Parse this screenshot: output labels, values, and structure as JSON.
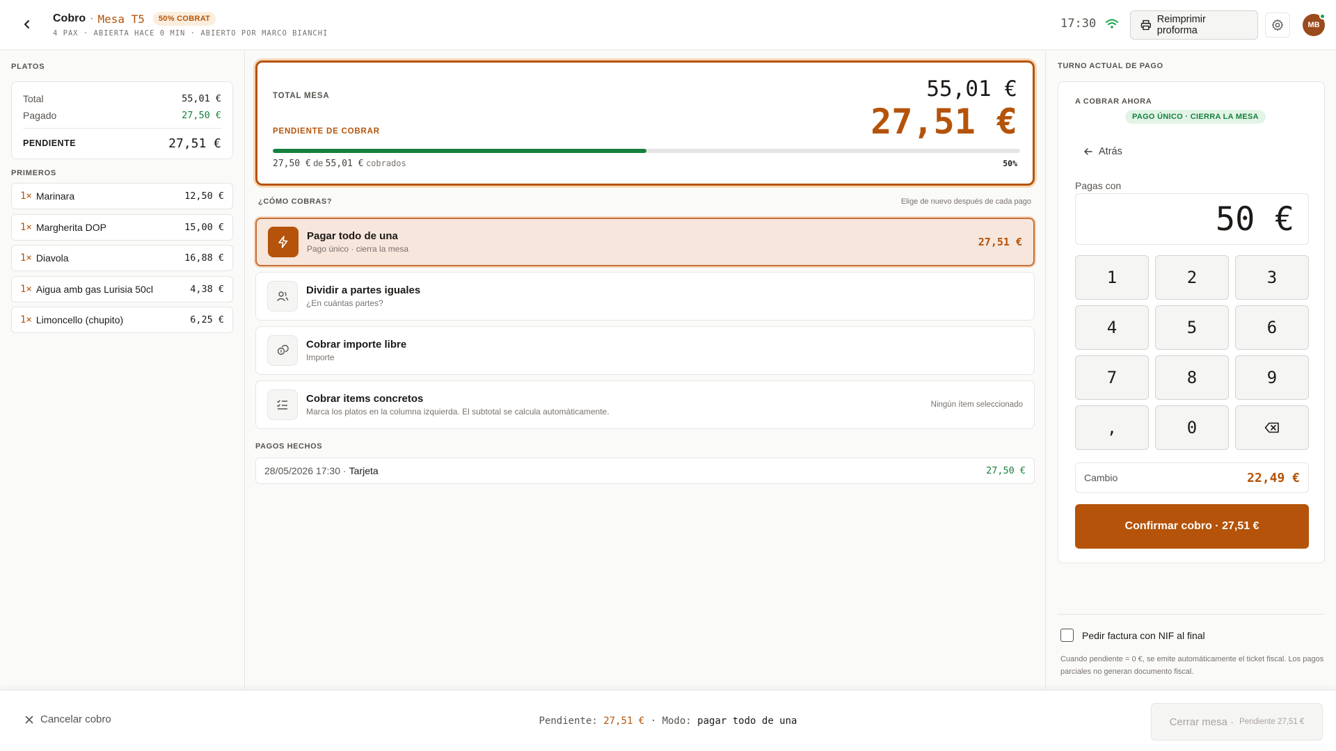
{
  "header": {
    "title": "Cobro",
    "separator": "·",
    "table": "Mesa T5",
    "badge": "50% COBRAT",
    "subtitle": "4 PAX · ABIERTA HACE 0 MIN · ABIERTO POR MARCO BIANCHI",
    "time": "17:30",
    "reprint_label": "Reimprimir proforma",
    "avatar_initials": "MB"
  },
  "left": {
    "platos_label": "PLATOS",
    "summary": {
      "total_label": "Total",
      "total_value": "55,01 €",
      "pagado_label": "Pagado",
      "pagado_value": "27,50 €",
      "pendiente_label": "PENDIENTE",
      "pendiente_value": "27,51 €"
    },
    "primeros_label": "PRIMEROS",
    "dishes": [
      {
        "qty": "1×",
        "name": "Marinara",
        "price": "12,50 €"
      },
      {
        "qty": "1×",
        "name": "Margherita DOP",
        "price": "15,00 €"
      },
      {
        "qty": "1×",
        "name": "Diavola",
        "price": "16,88 €"
      },
      {
        "qty": "1×",
        "name": "Aigua amb gas Lurisia 50cl",
        "price": "4,38 €"
      },
      {
        "qty": "1×",
        "name": "Limoncello (chupito)",
        "price": "6,25 €"
      }
    ]
  },
  "center": {
    "total_label": "TOTAL MESA",
    "total_value": "55,01 €",
    "pendiente_label": "PENDIENTE DE COBRAR",
    "pendiente_value": "27,51 €",
    "progress_fraction": 0.5,
    "progress_paid": "27,50 €",
    "progress_of": "de",
    "progress_total": "55,01 €",
    "progress_suffix": "cobrados",
    "progress_pct": "50%",
    "how_label": "¿CÓMO COBRAS?",
    "how_hint": "Elige de nuevo después de cada pago",
    "options": [
      {
        "title": "Pagar todo de una",
        "sub": "Pago único · cierra la mesa",
        "right": "27,51 €"
      },
      {
        "title": "Dividir a partes iguales",
        "sub": "¿En cuántas partes?",
        "right": ""
      },
      {
        "title": "Cobrar importe libre",
        "sub": "Importe",
        "right": ""
      },
      {
        "title": "Cobrar items concretos",
        "sub": "Marca los platos en la columna izquierda. El subtotal se calcula automáticamente.",
        "right": "Ningún ítem seleccionado"
      }
    ],
    "payments_label": "PAGOS HECHOS",
    "payments": [
      {
        "date": "28/05/2026 17:30",
        "sep": "·",
        "method": "Tarjeta",
        "amount": "27,50 €"
      }
    ]
  },
  "right": {
    "turn_label": "TURNO ACTUAL DE PAGO",
    "cobrar_label": "A COBRAR AHORA",
    "badge": "PAGO ÚNICO · CIERRA LA MESA",
    "back_label": "Atrás",
    "pagas_label": "Pagas con",
    "pagas_value": "50 €",
    "keys": [
      "1",
      "2",
      "3",
      "4",
      "5",
      "6",
      "7",
      "8",
      "9",
      ",",
      "0"
    ],
    "cambio_label": "Cambio",
    "cambio_value": "22,49 €",
    "confirm_label": "Confirmar cobro · 27,51 €",
    "nif_label": "Pedir factura con NIF al final",
    "nif_note": "Cuando pendiente = 0 €, se emite automáticamente el ticket fiscal. Los pagos parciales no generan documento fiscal."
  },
  "footer": {
    "cancel_label": "Cancelar cobro",
    "pend_label": "Pendiente:",
    "pend_value": "27,51 €",
    "sep": "·",
    "mode_label": "Modo:",
    "mode_value": "pagar todo de una",
    "close_label": "Cerrar mesa ·",
    "close_sub": "Pendiente 27,51 €"
  },
  "colors": {
    "accent": "#b45309",
    "success": "#15803d",
    "active_bg": "#f7e6dc"
  }
}
